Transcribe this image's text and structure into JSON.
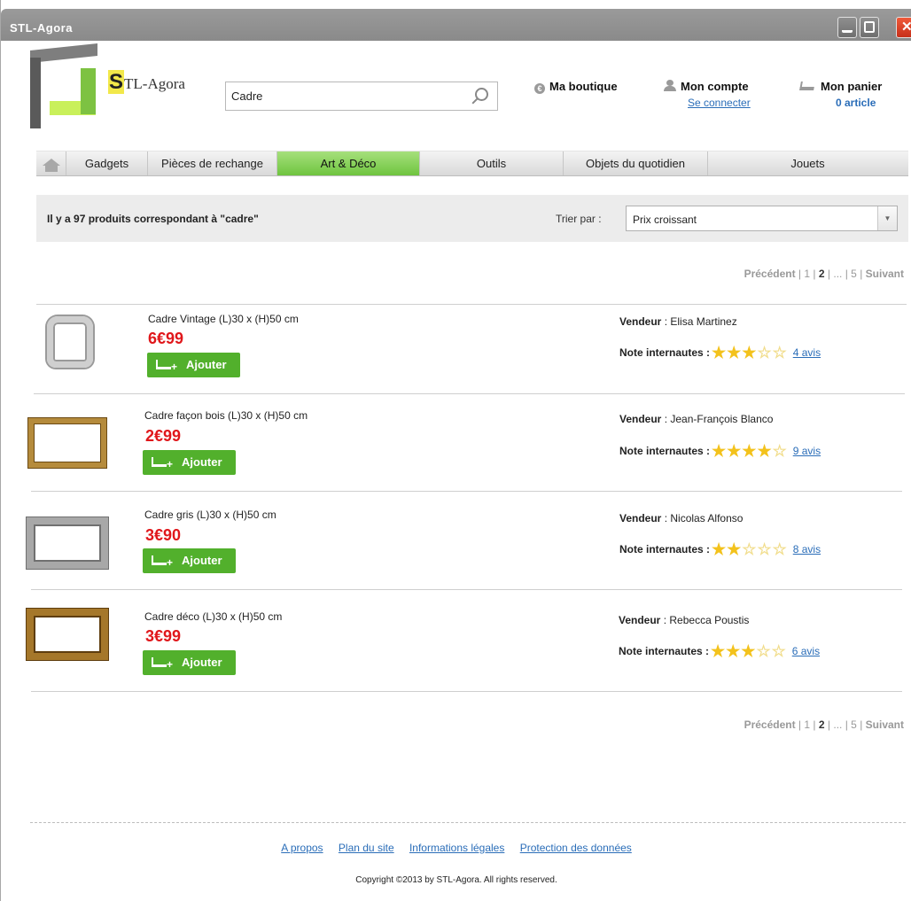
{
  "window": {
    "title": "STL-Agora"
  },
  "logo": {
    "letter": "S",
    "text": "TL-Agora"
  },
  "search": {
    "value": "Cadre"
  },
  "header": {
    "boutique": "Ma boutique",
    "compte": "Mon compte",
    "connect": "Se connecter",
    "panier": "Mon panier",
    "articles": "0 article"
  },
  "nav": {
    "tabs": [
      "Gadgets",
      "Pièces de rechange",
      "Art & Déco",
      "Outils",
      "Objets du quotidien",
      "Jouets"
    ],
    "active": "Art & Déco"
  },
  "sort": {
    "count_text": "Il y a 97 produits correspondant à \"cadre\"",
    "label": "Trier par :",
    "selected": "Prix croissant"
  },
  "pager": {
    "prev": "Précédent",
    "p1": "1",
    "p2": "2",
    "ellipsis": "...",
    "p5": "5",
    "next": "Suivant"
  },
  "labels": {
    "vendor": "Vendeur",
    "rating": "Note internautes :",
    "add": "Ajouter"
  },
  "products": [
    {
      "name": "Cadre Vintage (L)30 x (H)50 cm",
      "price": "6€99",
      "vendor": "Elisa Martinez",
      "stars": 3,
      "avis": "4 avis"
    },
    {
      "name": "Cadre façon bois (L)30 x (H)50 cm",
      "price": "2€99",
      "vendor": "Jean-François Blanco",
      "stars": 4,
      "avis": "9 avis"
    },
    {
      "name": "Cadre gris (L)30 x (H)50 cm",
      "price": "3€90",
      "vendor": "Nicolas Alfonso",
      "stars": 2,
      "avis": "8 avis"
    },
    {
      "name": "Cadre déco (L)30 x (H)50 cm",
      "price": "3€99",
      "vendor": "Rebecca Poustis",
      "stars": 3,
      "avis": "6 avis"
    }
  ],
  "colors": {
    "accent": "#52b02c",
    "price": "#e0171b",
    "link": "#2a6db8",
    "nav_active": "#6fc43f"
  },
  "footer": {
    "links": [
      "A propos",
      "Plan du site",
      "Informations légales",
      "Protection des données"
    ],
    "copyright": "Copyright ©2013 by STL-Agora. All rights reserved."
  }
}
